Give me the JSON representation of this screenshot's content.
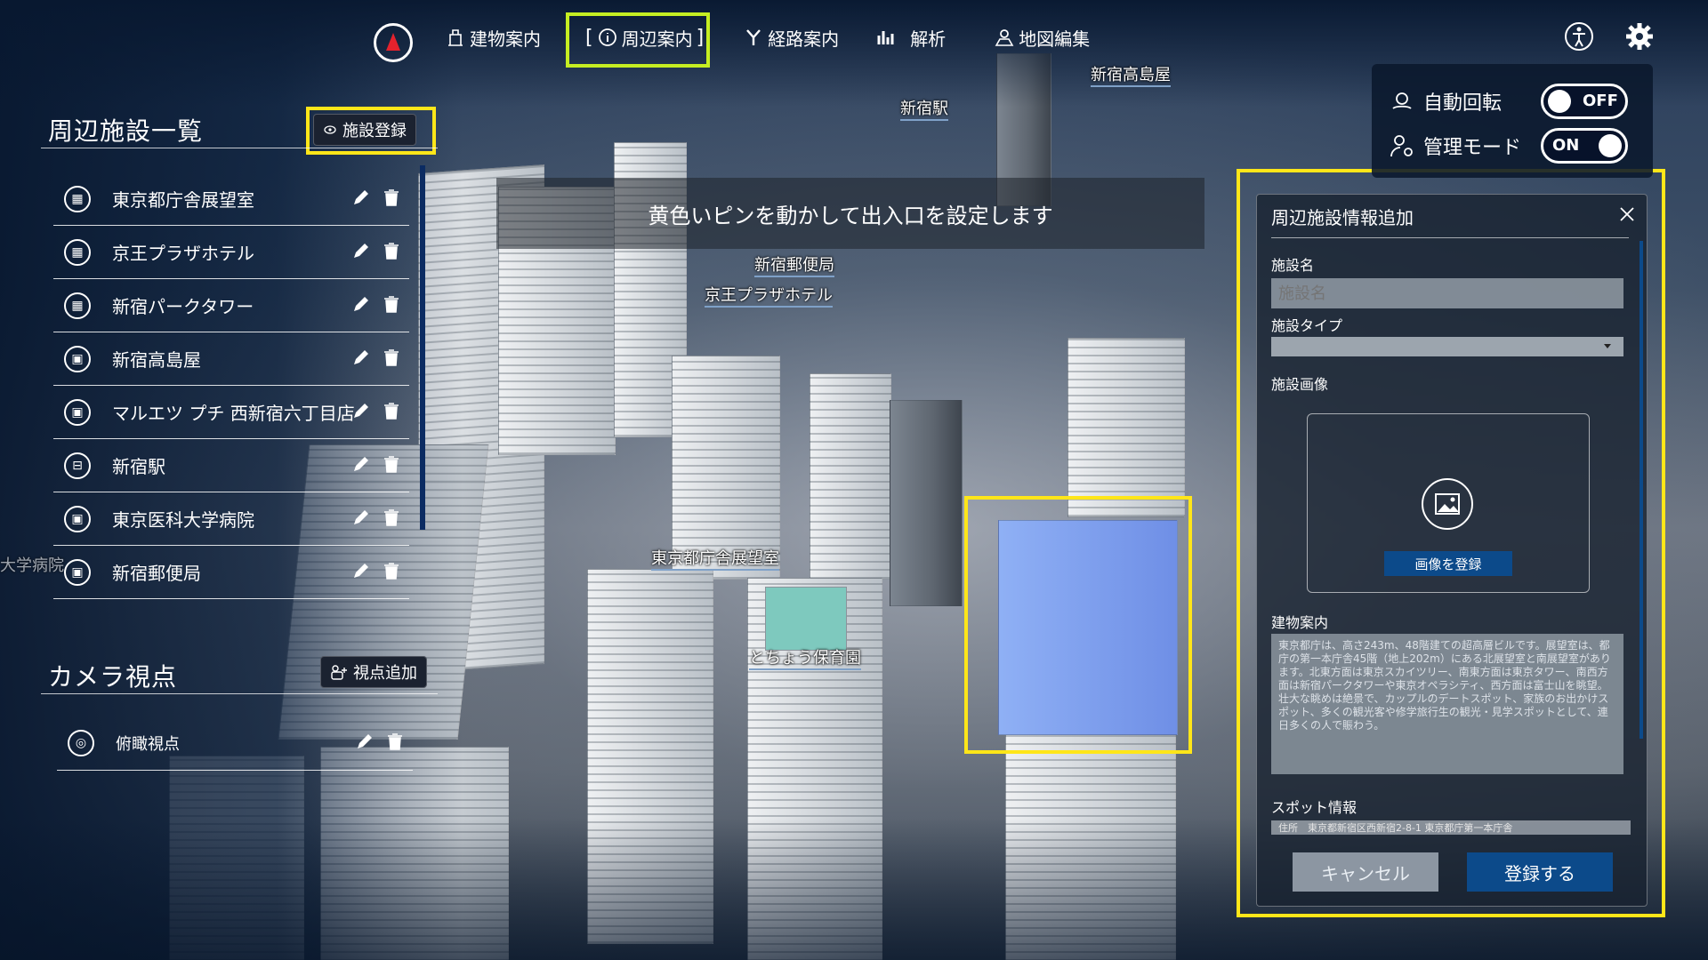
{
  "nav": {
    "items": [
      {
        "label": "建物案内",
        "icon": "building-icon"
      },
      {
        "label": "周辺案内",
        "icon": "info-icon"
      },
      {
        "label": "経路案内",
        "icon": "route-icon"
      },
      {
        "label": "解析",
        "icon": "analysis-icon"
      },
      {
        "label": "地図編集",
        "icon": "map-edit-icon"
      }
    ]
  },
  "facilities": {
    "title": "周辺施設一覧",
    "register_button": "施設登録",
    "items": [
      {
        "name": "東京都庁舎展望室",
        "icon": "building-icon"
      },
      {
        "name": "京王プラザホテル",
        "icon": "building-icon"
      },
      {
        "name": "新宿パークタワー",
        "icon": "building-icon"
      },
      {
        "name": "新宿高島屋",
        "icon": "shop-icon"
      },
      {
        "name": "マルエツ プチ 西新宿六丁目店",
        "icon": "shop-icon"
      },
      {
        "name": "新宿駅",
        "icon": "train-icon"
      },
      {
        "name": "東京医科大学病院",
        "icon": "shop-icon"
      },
      {
        "name": "新宿郵便局",
        "icon": "shop-icon"
      }
    ]
  },
  "camera": {
    "title": "カメラ視点",
    "add_button": "視点追加",
    "items": [
      {
        "name": "俯瞰視点"
      }
    ]
  },
  "banner": {
    "text": "黄色いピンを動かして出入口を設定します"
  },
  "map_labels": {
    "takashimaya": "新宿高島屋",
    "shinjuku_station": "新宿駅",
    "post_office": "新宿郵便局",
    "keio_plaza": "京王プラザホテル",
    "tocho": "東京都庁舎展望室",
    "nursery": "とちょう保育園",
    "hospital_partial": "大学病院"
  },
  "toggles": {
    "auto_rotate": {
      "label": "自動回転",
      "state": "OFF"
    },
    "admin_mode": {
      "label": "管理モード",
      "state": "ON"
    }
  },
  "form": {
    "title": "周辺施設情報追加",
    "name_label": "施設名",
    "name_placeholder": "施設名",
    "type_label": "施設タイプ",
    "image_label": "施設画像",
    "image_button": "画像を登録",
    "guide_label": "建物案内",
    "guide_text": "東京都庁は、高さ243m、48階建ての超高層ビルです。展望室は、都庁の第一本庁舎45階（地上202m）にある北展望室と南展望室があります。北東方面は東京スカイツリー、南東方面は東京タワー、南西方面は新宿パークタワーや東京オペラシティ、西方面は富士山を眺望。壮大な眺めは絶景で、カップルのデートスポット、家族のお出かけスポット、多くの観光客や修学旅行生の観光・見学スポットとして、連日多くの人で賑わう。",
    "spot_label": "スポット情報",
    "spot_text": "住所　東京都新宿区西新宿2-8-1 東京都庁第一本庁舎",
    "cancel": "キャンセル",
    "submit": "登録する"
  },
  "colors": {
    "highlight": "#ffe619",
    "nav_highlight": "#c6ee22",
    "primary": "#0c4a8a"
  }
}
